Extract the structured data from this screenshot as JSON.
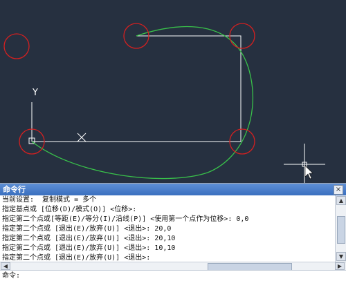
{
  "canvas": {
    "background": "#263040",
    "line_color": "#ffffff",
    "curve_color": "#39c24a",
    "circle_color": "#d42020",
    "axis_label": "Y"
  },
  "command_panel": {
    "title": "命令行",
    "close_glyph": "×",
    "history": [
      "当前设置:  复制模式 = 多个",
      "指定基点或 [位移(D)/模式(O)] <位移>:",
      "指定第二个点或[等距(E)/等分(I)/沿线(P)] <使用第一个点作为位移>: 0,0",
      "指定第二个点或 [退出(E)/放弃(U)] <退出>: 20,0",
      "指定第二个点或 [退出(E)/放弃(U)] <退出>: 20,10",
      "指定第二个点或 [退出(E)/放弃(U)] <退出>: 10,10",
      "指定第二个点或 [退出(E)/放弃(U)] <退出>:"
    ],
    "prompt_label": "命令:",
    "prompt_value": "",
    "scroll_up": "▲",
    "scroll_down": "▼",
    "scroll_left": "◀",
    "scroll_right": "▶"
  }
}
